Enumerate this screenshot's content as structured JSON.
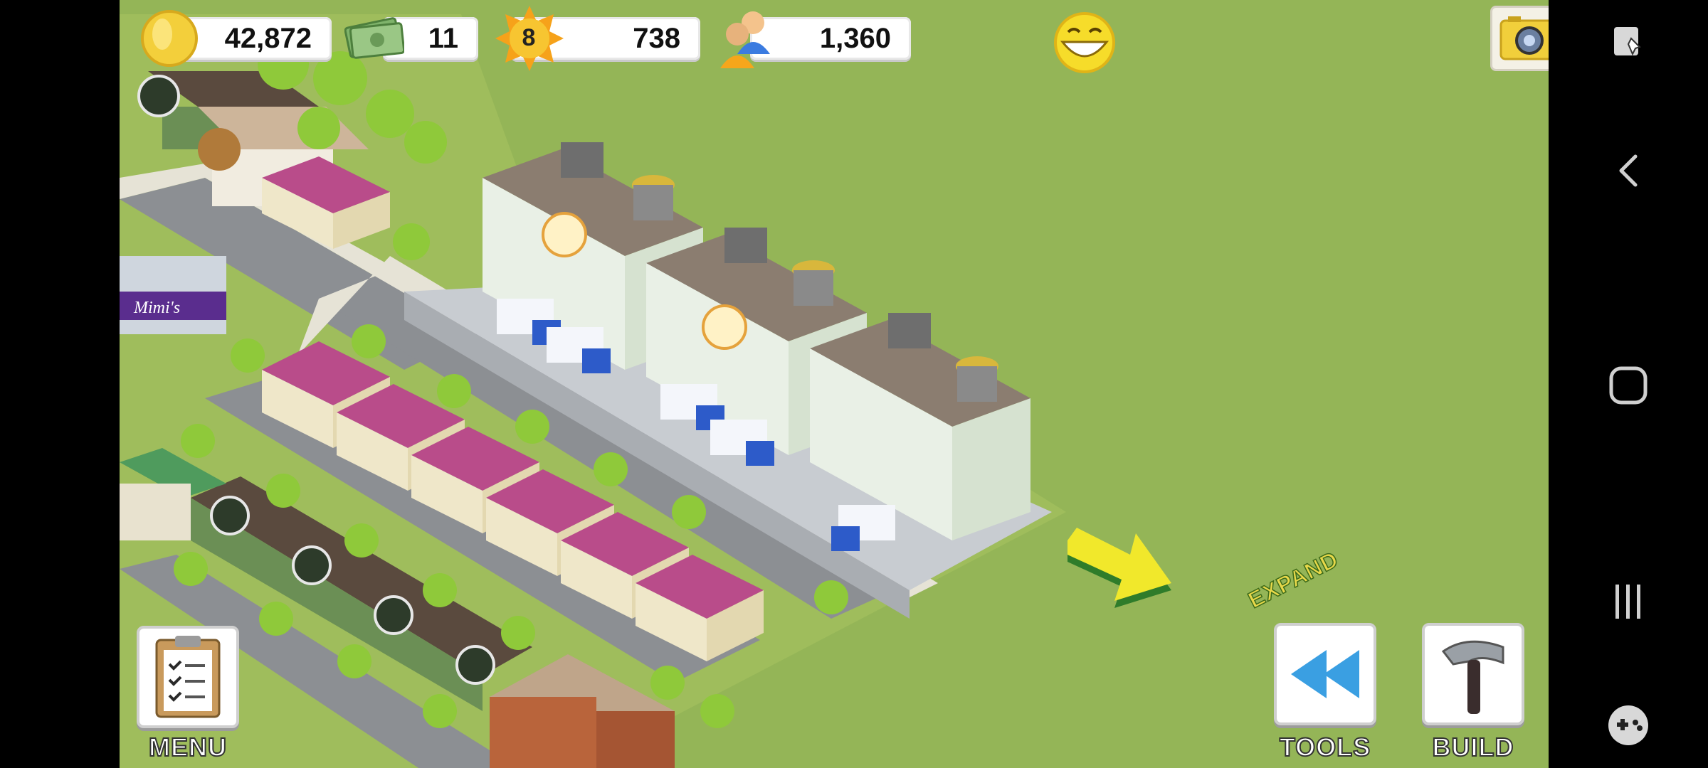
{
  "hud": {
    "coins": "42,872",
    "cash": "11",
    "level": "8",
    "xp": "738",
    "population": "1,360"
  },
  "scene": {
    "shop_sign": "Mimi's",
    "expand_label": "EXPAND"
  },
  "buttons": {
    "menu_label": "MENU",
    "tools_label": "TOOLS",
    "build_label": "BUILD"
  },
  "icons": {
    "coins": "gold-coin-icon",
    "cash": "cash-bills-icon",
    "level": "level-star-icon",
    "population": "population-icon",
    "happiness": "smiley-face-icon",
    "camera": "camera-icon",
    "share": "share-icon",
    "menu": "clipboard-icon",
    "tools": "rewind-icon",
    "build": "hammer-icon"
  },
  "colors": {
    "grass": "#94b557",
    "accent_blue": "#3fb6e6",
    "gold": "#f5d23a"
  }
}
